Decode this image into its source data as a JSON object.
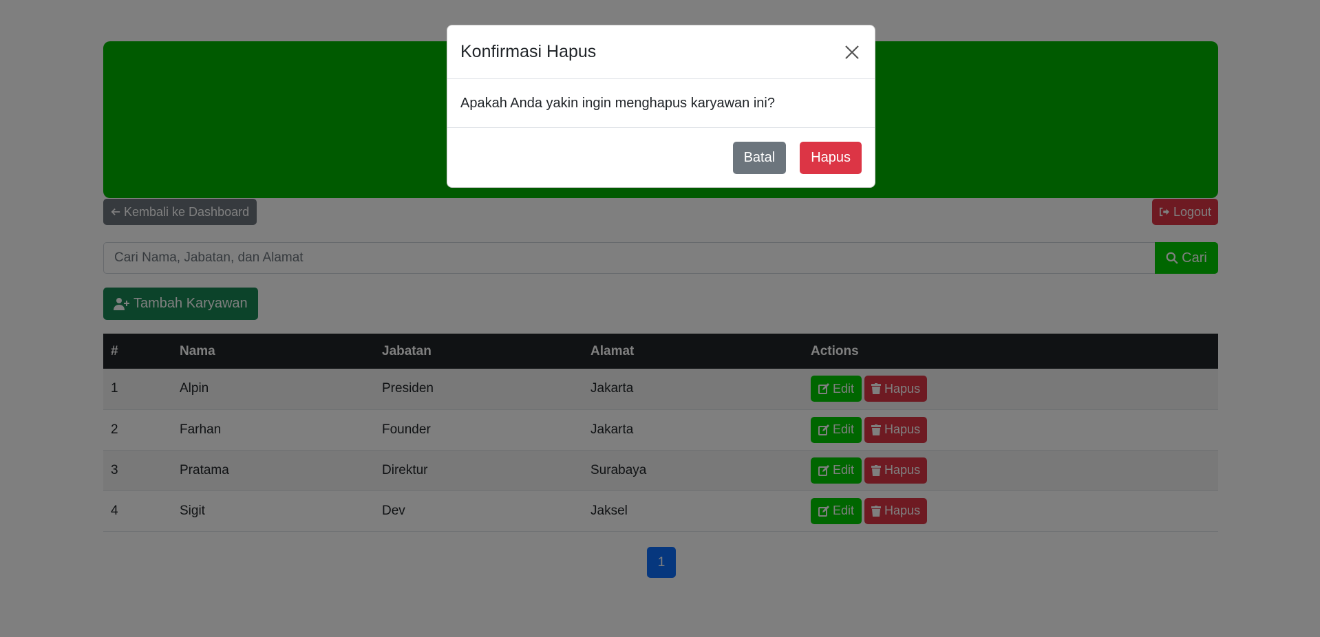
{
  "nav": {
    "back_label": "Kembali ke Dashboard",
    "logout_label": "Logout"
  },
  "search": {
    "placeholder": "Cari Nama, Jabatan, dan Alamat",
    "button_label": "Cari"
  },
  "add_button_label": "Tambah Karyawan",
  "table": {
    "headers": [
      "#",
      "Nama",
      "Jabatan",
      "Alamat",
      "Actions"
    ],
    "rows": [
      {
        "no": "1",
        "nama": "Alpin",
        "jabatan": "Presiden",
        "alamat": "Jakarta"
      },
      {
        "no": "2",
        "nama": "Farhan",
        "jabatan": "Founder",
        "alamat": "Jakarta"
      },
      {
        "no": "3",
        "nama": "Pratama",
        "jabatan": "Direktur",
        "alamat": "Surabaya"
      },
      {
        "no": "4",
        "nama": "Sigit",
        "jabatan": "Dev",
        "alamat": "Jaksel"
      }
    ],
    "edit_label": "Edit",
    "delete_label": "Hapus"
  },
  "pagination": {
    "current_page": "1"
  },
  "modal": {
    "title": "Konfirmasi Hapus",
    "message": "Apakah Anda yakin ingin menghapus karyawan ini?",
    "cancel_label": "Batal",
    "confirm_label": "Hapus"
  },
  "colors": {
    "banner": "#00b400",
    "primary": "#0d6efd",
    "success": "#00cc00",
    "danger": "#dc3545",
    "secondary": "#6c757d"
  },
  "icons": {
    "back": "arrow-left-icon",
    "logout": "logout-icon",
    "search": "search-icon",
    "add": "user-plus-icon",
    "edit": "edit-icon",
    "delete": "trash-icon",
    "close": "close-icon"
  }
}
